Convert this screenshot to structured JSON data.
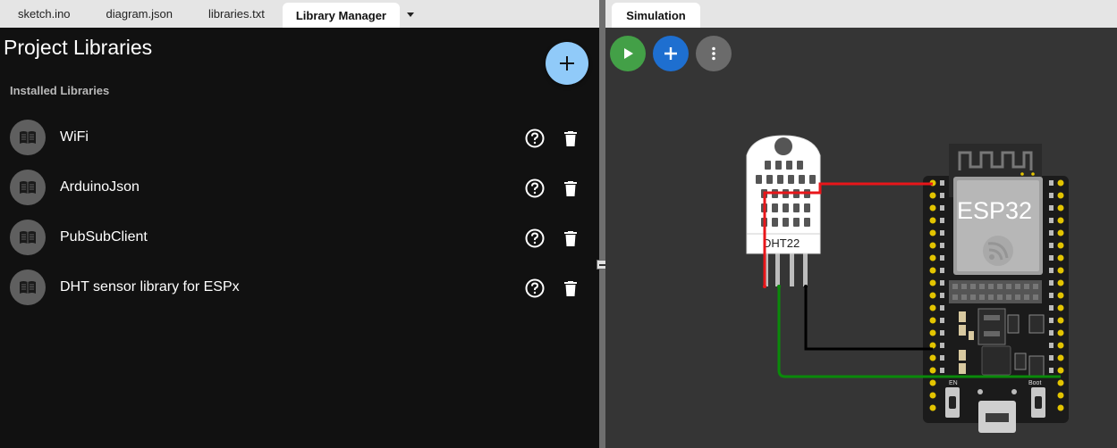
{
  "tabs": [
    {
      "label": "sketch.ino"
    },
    {
      "label": "diagram.json"
    },
    {
      "label": "libraries.txt"
    },
    {
      "label": "Library Manager"
    }
  ],
  "library_manager": {
    "title": "Project Libraries",
    "section_label": "Installed Libraries",
    "add_icon": "plus-icon",
    "libraries": [
      {
        "name": "WiFi"
      },
      {
        "name": "ArduinoJson"
      },
      {
        "name": "PubSubClient"
      },
      {
        "name": "DHT sensor library for ESPx"
      }
    ],
    "item_icon": "book-icon",
    "help_icon": "help-circle-icon",
    "delete_icon": "trash-icon"
  },
  "simulation": {
    "tab_label": "Simulation",
    "controls": [
      "play-icon",
      "plus-icon",
      "more-vert-icon"
    ],
    "sensor_label": "DHT22",
    "board_label": "ESP32",
    "board_buttons": {
      "left": "EN",
      "right": "Boot"
    }
  },
  "colors": {
    "play": "#43a047",
    "add": "#1e6fd0",
    "fab": "#90caf9",
    "wire_red": "#e8161a",
    "wire_black": "#000000",
    "wire_green": "#0a8a0a"
  }
}
